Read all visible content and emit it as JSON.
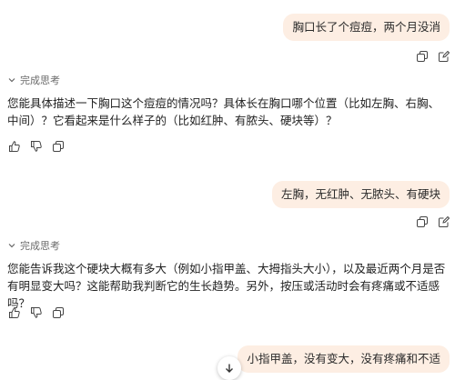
{
  "messages": [
    {
      "role": "user",
      "text": "胸口长了个痘痘，两个月没消"
    },
    {
      "role": "assistant",
      "thinking_label": "完成思考",
      "text": "您能具体描述一下胸口这个痘痘的情况吗？具体长在胸口哪个位置（比如左胸、右胸、中间）？它看起来是什么样子的（比如红肿、有脓头、硬块等）？"
    },
    {
      "role": "user",
      "text": "左胸，无红肿、无脓头、有硬块"
    },
    {
      "role": "assistant",
      "thinking_label": "完成思考",
      "text": "您能告诉我这个硬块大概有多大（例如小指甲盖、大拇指头大小），以及最近两个月是否有明显变大吗？这能帮助我判断它的生长趋势。另外，按压或活动时会有疼痛或不适感吗？"
    },
    {
      "role": "user",
      "text": "小指甲盖，没有变大，没有疼痛和不适"
    }
  ],
  "icons": {
    "copy": "copy-icon",
    "edit": "edit-icon",
    "like": "thumbs-up-icon",
    "dislike": "thumbs-down-icon",
    "chevron": "chevron-down-icon",
    "scroll": "arrow-down-icon"
  },
  "colors": {
    "user_bubble": "#fdeee3",
    "muted": "#6b6b6b"
  }
}
